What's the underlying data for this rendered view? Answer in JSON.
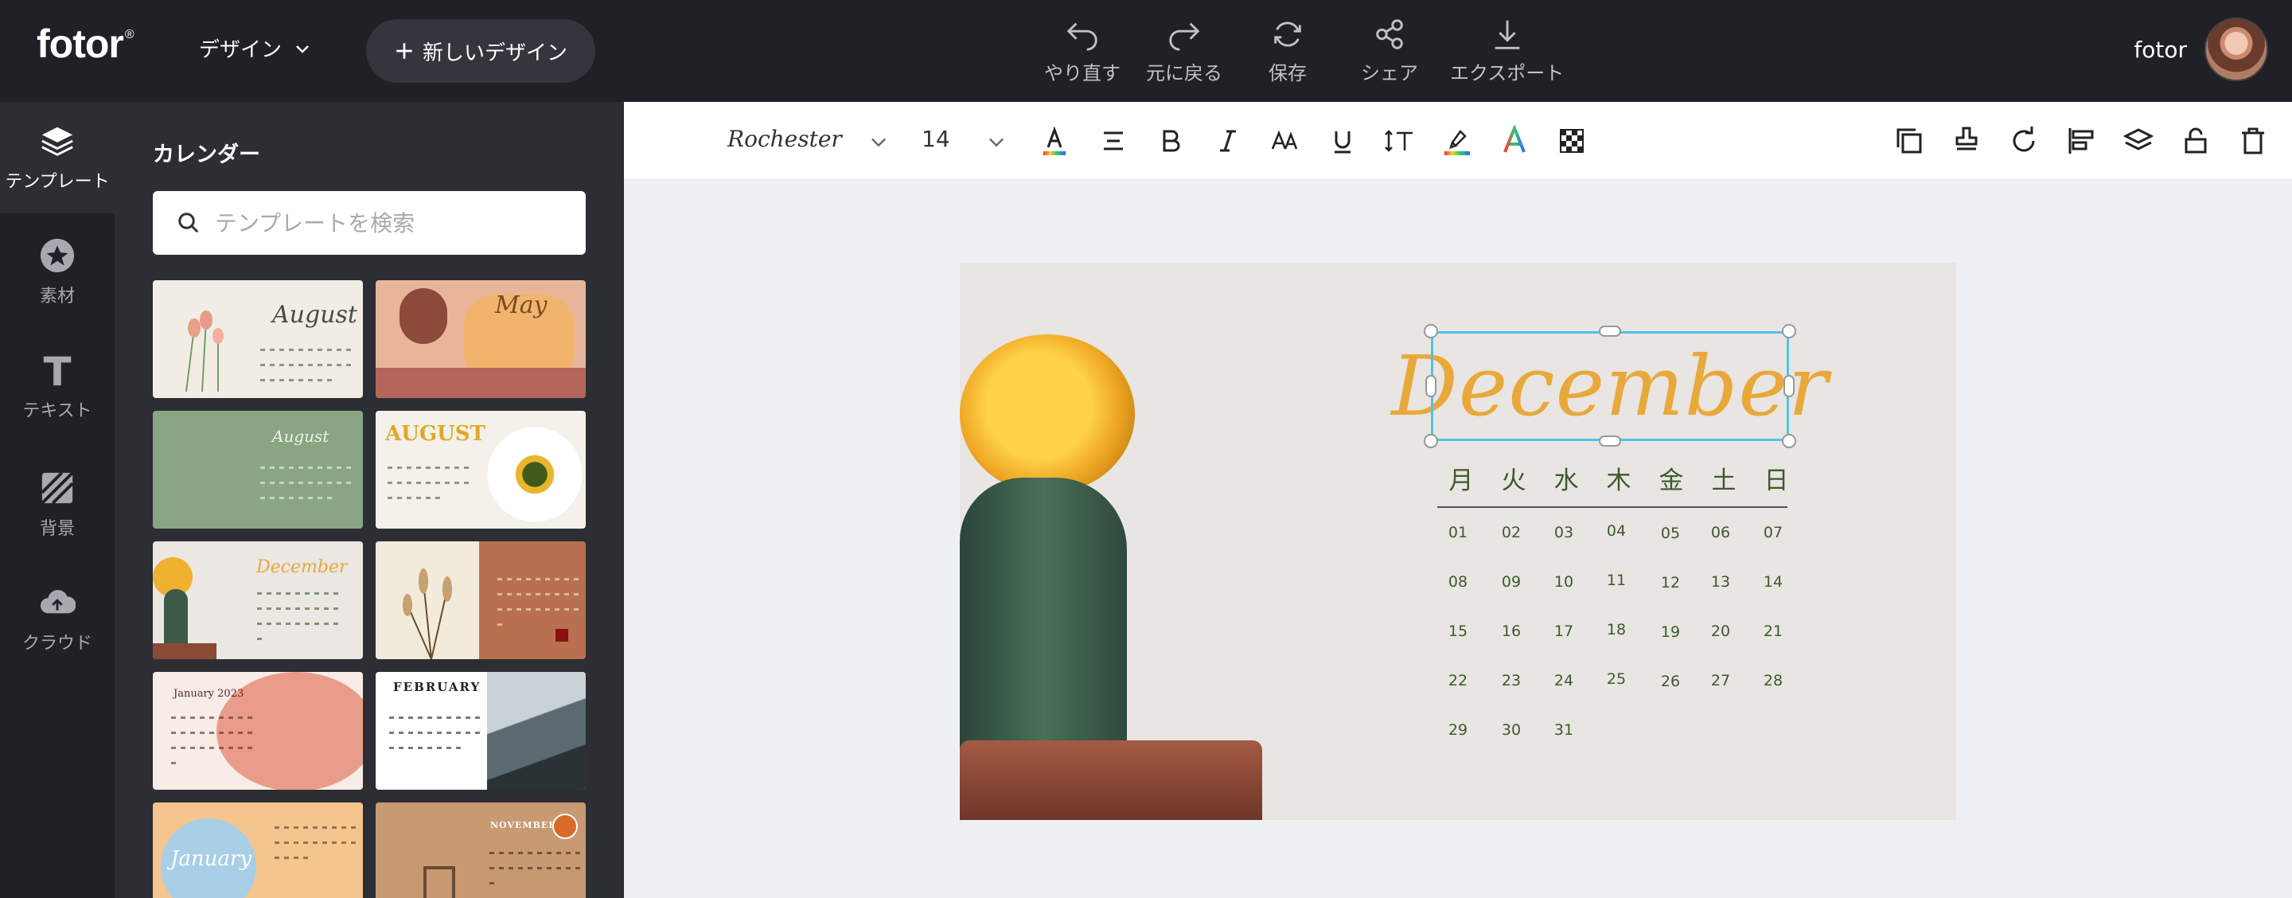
{
  "app": {
    "logo": "fotor",
    "logo_mark": "®"
  },
  "topbar": {
    "design_menu": "デザイン",
    "new_design": "新しいデザイン",
    "actions": [
      {
        "id": "undo",
        "label": "やり直す"
      },
      {
        "id": "redo",
        "label": "元に戻る"
      },
      {
        "id": "save",
        "label": "保存"
      },
      {
        "id": "share",
        "label": "シェア"
      },
      {
        "id": "export",
        "label": "エクスポート"
      }
    ],
    "user_name": "fotor"
  },
  "rail": {
    "items": [
      {
        "label": "テンプレート",
        "icon": "layers-icon"
      },
      {
        "label": "素材",
        "icon": "star-icon"
      },
      {
        "label": "テキスト",
        "icon": "text-icon"
      },
      {
        "label": "背景",
        "icon": "background-icon"
      },
      {
        "label": "クラウド",
        "icon": "cloud-upload-icon"
      }
    ]
  },
  "panel": {
    "title": "カレンダー",
    "search_placeholder": "テンプレートを検索",
    "thumbnails": [
      {
        "caption": "August"
      },
      {
        "caption": "May"
      },
      {
        "caption": "August"
      },
      {
        "caption": "AUGUST"
      },
      {
        "caption": "December"
      },
      {
        "caption": ""
      },
      {
        "caption": "January 2023"
      },
      {
        "caption": "FEBRUARY"
      },
      {
        "caption": "January"
      },
      {
        "caption": "NOVEMBER"
      }
    ]
  },
  "textbar": {
    "font": "Rochester",
    "size": "14"
  },
  "calendar": {
    "month": "December",
    "weekdays": [
      "月",
      "火",
      "水",
      "木",
      "金",
      "土",
      "日"
    ],
    "weeks": [
      [
        "01",
        "02",
        "03",
        "04",
        "05",
        "06",
        "07"
      ],
      [
        "08",
        "09",
        "10",
        "11",
        "12",
        "13",
        "14"
      ],
      [
        "15",
        "16",
        "17",
        "18",
        "19",
        "20",
        "21"
      ],
      [
        "22",
        "23",
        "24",
        "25",
        "26",
        "27",
        "28"
      ],
      [
        "29",
        "30",
        "31"
      ]
    ],
    "accent_color": "#e8a93a",
    "text_color": "#3e5a2e"
  }
}
